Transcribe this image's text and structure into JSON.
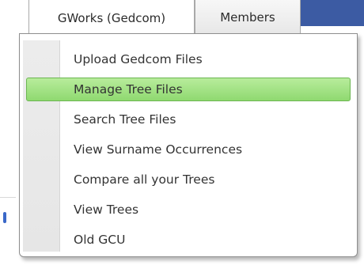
{
  "nav": {
    "tabs": [
      {
        "label": "GWorks (Gedcom)"
      },
      {
        "label": "Members"
      }
    ]
  },
  "menu": {
    "items": [
      {
        "label": "Upload Gedcom Files"
      },
      {
        "label": "Manage Tree Files",
        "selected": true
      },
      {
        "label": "Search Tree Files"
      },
      {
        "label": "View Surname Occurrences"
      },
      {
        "label": "Compare all your Trees"
      },
      {
        "label": "View Trees"
      },
      {
        "label": "Old GCU"
      }
    ],
    "highlight_color": "#9fe07f"
  },
  "colors": {
    "header_blue": "#3c5ba3",
    "link_blue": "#3a68c8"
  }
}
